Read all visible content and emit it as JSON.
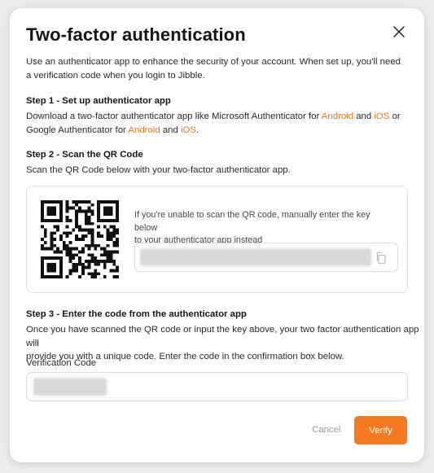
{
  "dialog": {
    "title": "Two-factor authentication",
    "intro_line1": "Use an authenticator app to enhance the security of your account. When set up, you'll need",
    "intro_line2": "a verification code when you login to Jibble."
  },
  "step1": {
    "heading": "Step 1 - Set up authenticator app",
    "line1_text_a": "Download a two-factor authenticator app like Microsoft Authenticator for ",
    "line1_link_android": "Android",
    "line1_text_and": " and ",
    "line1_link_ios": "iOS",
    "line1_text_or": " or",
    "line2_text_a": "Google Authenticator for ",
    "line2_link_android": "Android",
    "line2_text_and": " and ",
    "line2_link_ios": "iOS",
    "line2_text_end": "."
  },
  "step2": {
    "heading": "Step 2 - Scan the QR Code",
    "instruction": "Scan the QR Code below with your two-factor authenticator app.",
    "hint_line1": "If you're unable to scan the QR code, manually enter the key below",
    "hint_line2": "to your authenticator app instead"
  },
  "step3": {
    "heading": "Step 3 - Enter the code from the authenticator app",
    "line1": "Once you have scanned the QR code or input the key above, your two factor authentication app will",
    "line2": "provide you with a unique code. Enter the code in the confirmation box below.",
    "field_label": "Verification Code"
  },
  "actions": {
    "cancel_label": "Cancel",
    "verify_label": "Verify"
  },
  "colors": {
    "accent": "#f57a22",
    "link": "#f27520"
  },
  "icons": {
    "close": "close-icon",
    "copy": "copy-icon"
  }
}
